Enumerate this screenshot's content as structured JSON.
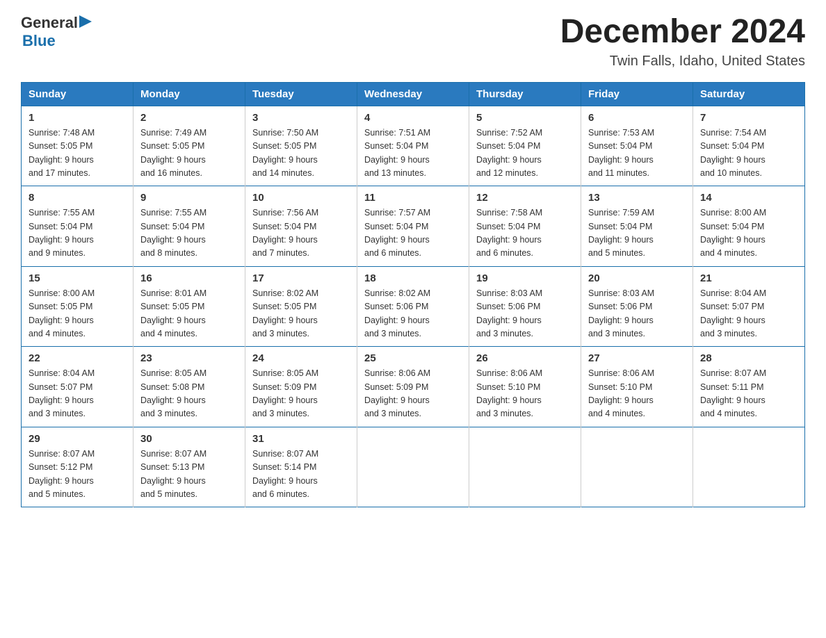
{
  "header": {
    "logo_general": "General",
    "logo_blue": "Blue",
    "month_title": "December 2024",
    "location": "Twin Falls, Idaho, United States"
  },
  "days_of_week": [
    "Sunday",
    "Monday",
    "Tuesday",
    "Wednesday",
    "Thursday",
    "Friday",
    "Saturday"
  ],
  "weeks": [
    [
      {
        "day": "1",
        "sunrise": "7:48 AM",
        "sunset": "5:05 PM",
        "daylight": "9 hours and 17 minutes."
      },
      {
        "day": "2",
        "sunrise": "7:49 AM",
        "sunset": "5:05 PM",
        "daylight": "9 hours and 16 minutes."
      },
      {
        "day": "3",
        "sunrise": "7:50 AM",
        "sunset": "5:05 PM",
        "daylight": "9 hours and 14 minutes."
      },
      {
        "day": "4",
        "sunrise": "7:51 AM",
        "sunset": "5:04 PM",
        "daylight": "9 hours and 13 minutes."
      },
      {
        "day": "5",
        "sunrise": "7:52 AM",
        "sunset": "5:04 PM",
        "daylight": "9 hours and 12 minutes."
      },
      {
        "day": "6",
        "sunrise": "7:53 AM",
        "sunset": "5:04 PM",
        "daylight": "9 hours and 11 minutes."
      },
      {
        "day": "7",
        "sunrise": "7:54 AM",
        "sunset": "5:04 PM",
        "daylight": "9 hours and 10 minutes."
      }
    ],
    [
      {
        "day": "8",
        "sunrise": "7:55 AM",
        "sunset": "5:04 PM",
        "daylight": "9 hours and 9 minutes."
      },
      {
        "day": "9",
        "sunrise": "7:55 AM",
        "sunset": "5:04 PM",
        "daylight": "9 hours and 8 minutes."
      },
      {
        "day": "10",
        "sunrise": "7:56 AM",
        "sunset": "5:04 PM",
        "daylight": "9 hours and 7 minutes."
      },
      {
        "day": "11",
        "sunrise": "7:57 AM",
        "sunset": "5:04 PM",
        "daylight": "9 hours and 6 minutes."
      },
      {
        "day": "12",
        "sunrise": "7:58 AM",
        "sunset": "5:04 PM",
        "daylight": "9 hours and 6 minutes."
      },
      {
        "day": "13",
        "sunrise": "7:59 AM",
        "sunset": "5:04 PM",
        "daylight": "9 hours and 5 minutes."
      },
      {
        "day": "14",
        "sunrise": "8:00 AM",
        "sunset": "5:04 PM",
        "daylight": "9 hours and 4 minutes."
      }
    ],
    [
      {
        "day": "15",
        "sunrise": "8:00 AM",
        "sunset": "5:05 PM",
        "daylight": "9 hours and 4 minutes."
      },
      {
        "day": "16",
        "sunrise": "8:01 AM",
        "sunset": "5:05 PM",
        "daylight": "9 hours and 4 minutes."
      },
      {
        "day": "17",
        "sunrise": "8:02 AM",
        "sunset": "5:05 PM",
        "daylight": "9 hours and 3 minutes."
      },
      {
        "day": "18",
        "sunrise": "8:02 AM",
        "sunset": "5:06 PM",
        "daylight": "9 hours and 3 minutes."
      },
      {
        "day": "19",
        "sunrise": "8:03 AM",
        "sunset": "5:06 PM",
        "daylight": "9 hours and 3 minutes."
      },
      {
        "day": "20",
        "sunrise": "8:03 AM",
        "sunset": "5:06 PM",
        "daylight": "9 hours and 3 minutes."
      },
      {
        "day": "21",
        "sunrise": "8:04 AM",
        "sunset": "5:07 PM",
        "daylight": "9 hours and 3 minutes."
      }
    ],
    [
      {
        "day": "22",
        "sunrise": "8:04 AM",
        "sunset": "5:07 PM",
        "daylight": "9 hours and 3 minutes."
      },
      {
        "day": "23",
        "sunrise": "8:05 AM",
        "sunset": "5:08 PM",
        "daylight": "9 hours and 3 minutes."
      },
      {
        "day": "24",
        "sunrise": "8:05 AM",
        "sunset": "5:09 PM",
        "daylight": "9 hours and 3 minutes."
      },
      {
        "day": "25",
        "sunrise": "8:06 AM",
        "sunset": "5:09 PM",
        "daylight": "9 hours and 3 minutes."
      },
      {
        "day": "26",
        "sunrise": "8:06 AM",
        "sunset": "5:10 PM",
        "daylight": "9 hours and 3 minutes."
      },
      {
        "day": "27",
        "sunrise": "8:06 AM",
        "sunset": "5:10 PM",
        "daylight": "9 hours and 4 minutes."
      },
      {
        "day": "28",
        "sunrise": "8:07 AM",
        "sunset": "5:11 PM",
        "daylight": "9 hours and 4 minutes."
      }
    ],
    [
      {
        "day": "29",
        "sunrise": "8:07 AM",
        "sunset": "5:12 PM",
        "daylight": "9 hours and 5 minutes."
      },
      {
        "day": "30",
        "sunrise": "8:07 AM",
        "sunset": "5:13 PM",
        "daylight": "9 hours and 5 minutes."
      },
      {
        "day": "31",
        "sunrise": "8:07 AM",
        "sunset": "5:14 PM",
        "daylight": "9 hours and 6 minutes."
      },
      null,
      null,
      null,
      null
    ]
  ],
  "labels": {
    "sunrise": "Sunrise:",
    "sunset": "Sunset:",
    "daylight": "Daylight:"
  }
}
